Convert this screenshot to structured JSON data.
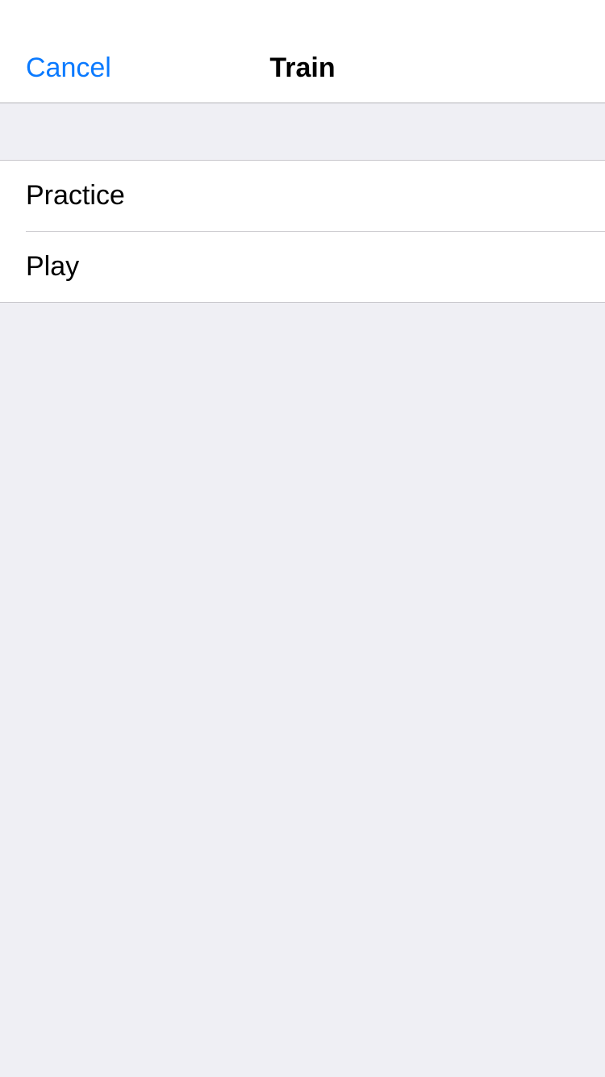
{
  "nav": {
    "cancel_label": "Cancel",
    "title": "Train"
  },
  "menu": {
    "items": [
      {
        "label": "Practice"
      },
      {
        "label": "Play"
      }
    ]
  },
  "colors": {
    "accent": "#0a7aff",
    "background": "#efeff4",
    "separator": "#c8c7cc"
  }
}
